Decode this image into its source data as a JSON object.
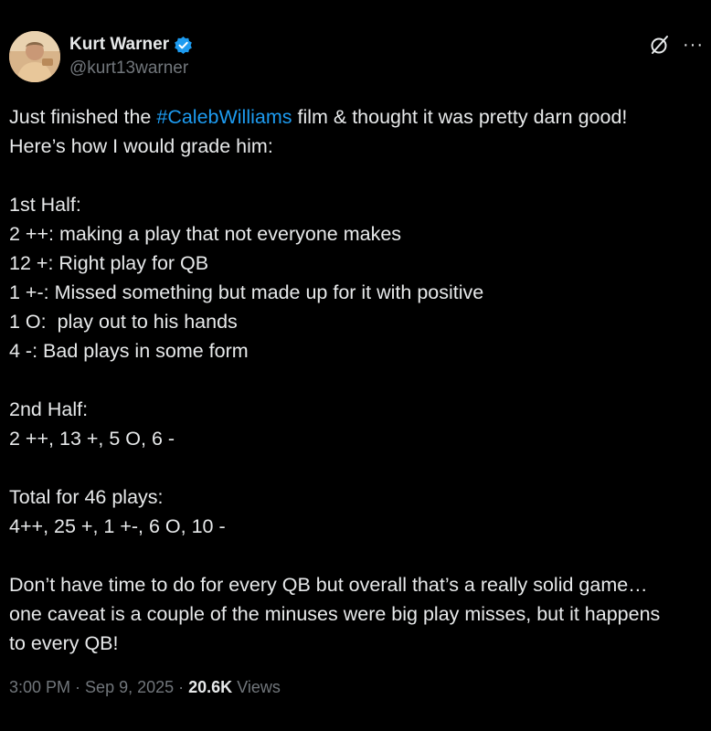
{
  "author": {
    "display_name": "Kurt Warner",
    "handle": "@kurt13warner",
    "verified": true
  },
  "tweet": {
    "intro_line1_before": "Just finished the ",
    "hashtag": "#CalebWilliams",
    "intro_line1_after": " film & thought it was pretty darn good!",
    "intro_line2": "Here’s how I would grade him:",
    "first_half_heading": "1st Half:",
    "first_half_lines": [
      "2 ++: making a play that not everyone makes",
      "12 +: Right play for QB",
      "1 +-: Missed something but made up for it with positive",
      "1 O:  play out to his hands",
      "4 -: Bad plays in some form"
    ],
    "second_half_heading": "2nd Half:",
    "second_half_line": "2 ++, 13 +, 5 O, 6 -",
    "total_heading": "Total for 46 plays:",
    "total_line": "4++, 25 +, 1 +-, 6 O, 10 -",
    "closing_lines": [
      "Don’t have time to do for every QB but overall that’s a really solid game…",
      "one caveat is a couple of the minuses were big play misses, but it happens",
      "to every QB!"
    ]
  },
  "meta": {
    "time": "3:00 PM",
    "date": "Sep 9, 2025",
    "separator": " · ",
    "views_count": "20.6K",
    "views_label": " Views"
  },
  "icons": {
    "verified": "verified-badge-icon",
    "grok": "grok-icon",
    "more": "more-icon"
  },
  "colors": {
    "background": "#000000",
    "text": "#e7e9ea",
    "secondary": "#71767b",
    "link": "#1d9bf0"
  }
}
